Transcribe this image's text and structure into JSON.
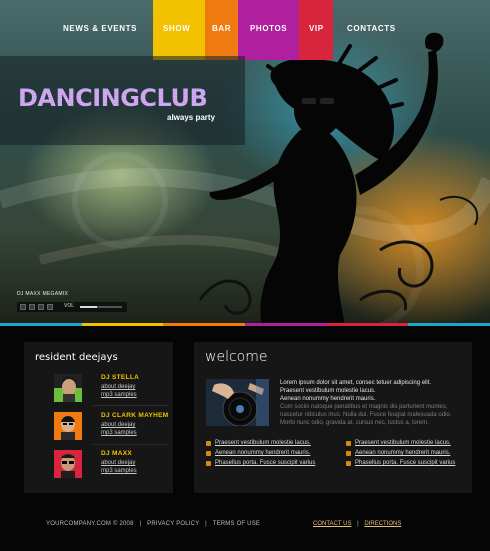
{
  "nav": {
    "items": [
      {
        "label": "NEWS & EVENTS",
        "color": ""
      },
      {
        "label": "SHOW",
        "color": "#f2c200"
      },
      {
        "label": "BAR",
        "color": "#ee7a10"
      },
      {
        "label": "PHOTOS",
        "color": "#b01f9e"
      },
      {
        "label": "VIP",
        "color": "#d8243c"
      },
      {
        "label": "CONTACTS",
        "color": ""
      }
    ]
  },
  "logo": {
    "title": "DANCINGCLUB",
    "tagline": "always party"
  },
  "player": {
    "label": "DJ MAXX MEGAMIX",
    "volume_label": "VOL",
    "volume": 0.4
  },
  "color_strip": [
    "#1ca6c8",
    "#f2c200",
    "#ee7a10",
    "#b01f9e",
    "#d8243c",
    "#1ca6c8"
  ],
  "deejays": {
    "title": "resident deejays",
    "items": [
      {
        "name": "DJ STELLA",
        "about": "about deejay",
        "samples": "mp3 samples",
        "accent": "#6cbf3c"
      },
      {
        "name": "DJ CLARK MAYHEM",
        "about": "about deejay",
        "samples": "mp3 samples",
        "accent": "#ee7a10"
      },
      {
        "name": "DJ MAXX",
        "about": "about deejay",
        "samples": "mp3 samples",
        "accent": "#d8243c"
      }
    ]
  },
  "welcome": {
    "title": "welcome",
    "paragraph_highlight": [
      "Lorem ipsum dolor sit amet, consec tetuer adipiscing elit.",
      "Praesent vestibulum molestie lacus.",
      "Aenean nonummy hendrerit mauris."
    ],
    "paragraph_dim": [
      "Cum sociis natoque penatibus et magnis dis parturient montes,",
      "nascetur ridiculus mus. Nulla dui. Fusce feugiat malesuada odio.",
      "Morbi nunc odio, gravida at, cursus nec, luctus a, lorem."
    ],
    "links_left": [
      "Praesent vestibulum molestie lacus.",
      "Aenean nonummy hendrerit mauris.",
      "Phasellus porta. Fusce suscipit varius"
    ],
    "links_right": [
      "Praesent vestibulum molestie lacus.",
      "Aenean nonummy hendrerit mauris.",
      "Phasellus porta. Fusce suscipit varius"
    ]
  },
  "footer": {
    "copyright": "YOURCOMPANY.COM © 2008",
    "privacy": "PRIVACY POLICY",
    "terms": "TERMS OF USE",
    "contact": "CONTACT US",
    "directions": "DIRECTIONS"
  },
  "icons": [
    "play-icon",
    "pause-icon",
    "stop-icon",
    "next-icon",
    "link-bullet-icon"
  ]
}
